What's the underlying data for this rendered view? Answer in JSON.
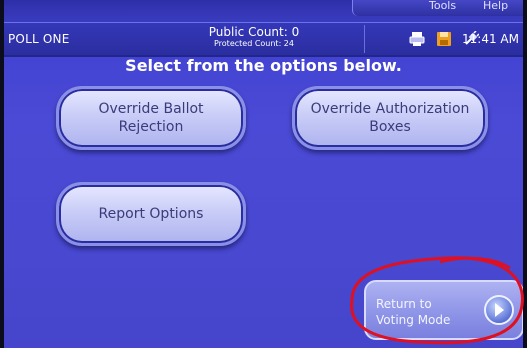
{
  "top_menu": {
    "tools": "Tools",
    "help": "Help"
  },
  "status_bar": {
    "poll_name": "POLL ONE",
    "public_count": "Public Count: 0",
    "protected_count": "Protected Count: 24",
    "time": "11:41 AM",
    "icons": [
      "printer-icon",
      "disk-icon",
      "plug-icon"
    ]
  },
  "main": {
    "heading": "Select from the options below.",
    "buttons": {
      "override_ballot": "Override Ballot\nRejection",
      "override_auth": "Override Authorization\nBoxes",
      "report_options": "Report Options",
      "return": "Return to\nVoting Mode"
    }
  },
  "colors": {
    "screen_bg": "#4646cc",
    "status_bar": "#2b2e9f",
    "button_face": "#c9cdf7",
    "annotation_circle": "#e01020"
  }
}
